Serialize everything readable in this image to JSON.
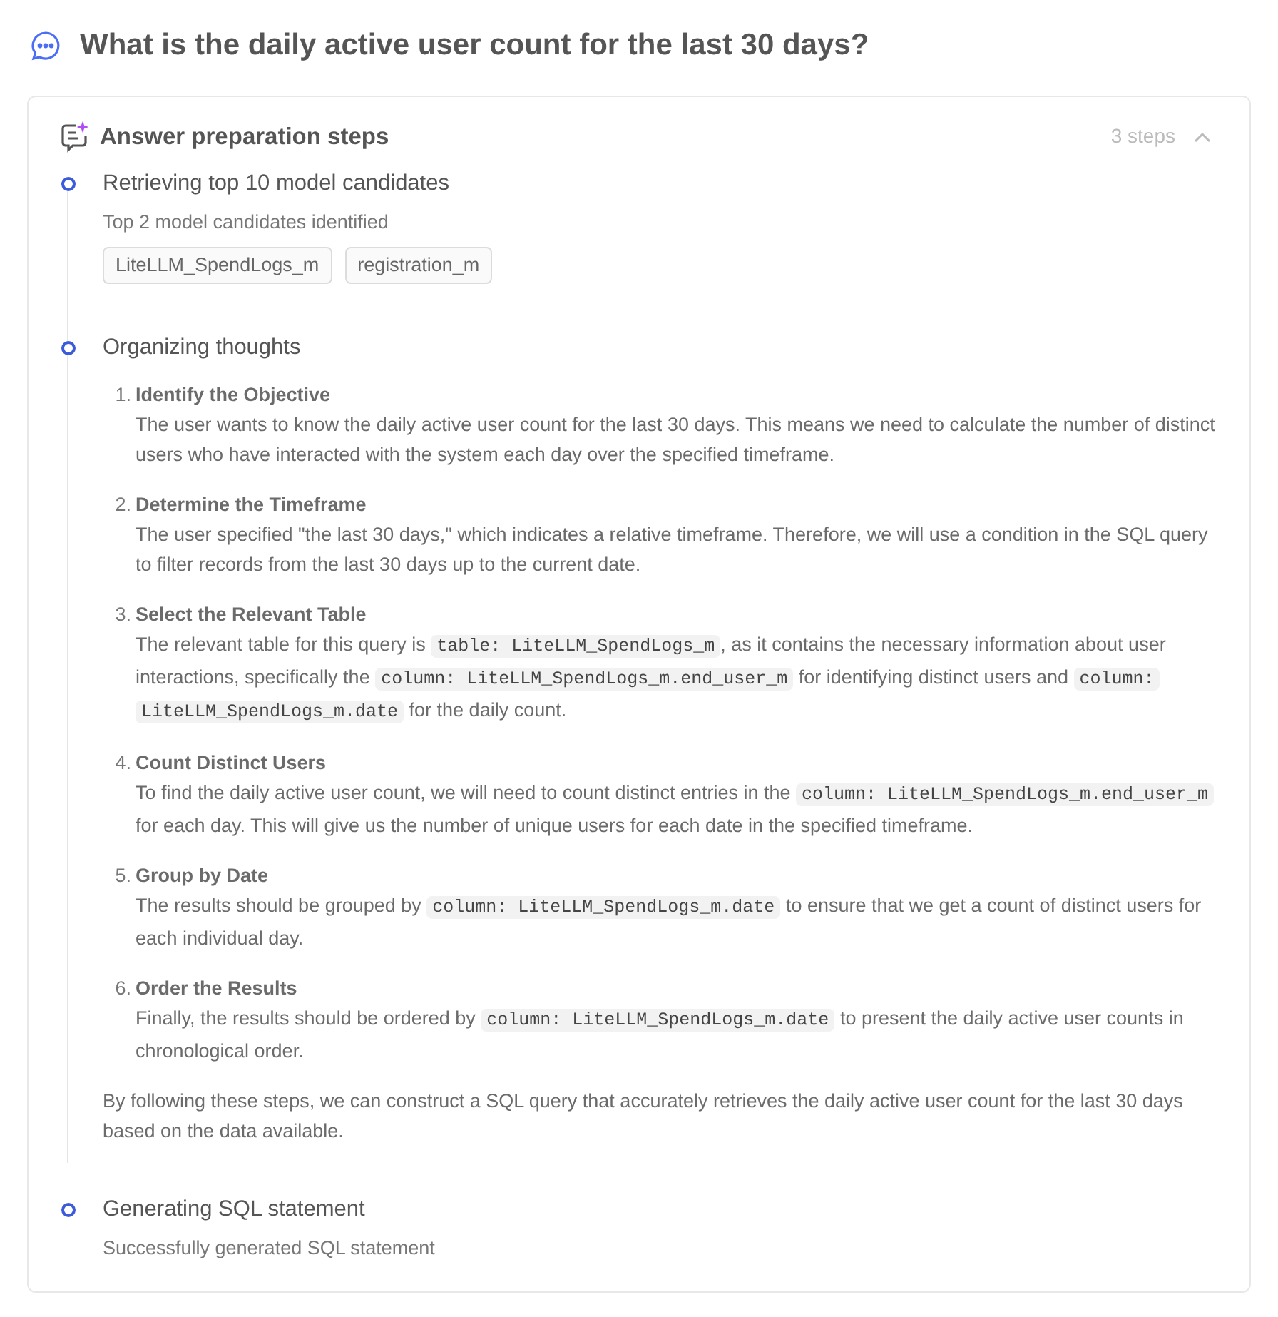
{
  "question": "What is the daily active user count for the last 30 days?",
  "panel": {
    "title": "Answer preparation steps",
    "count": "3 steps",
    "expanded": true
  },
  "steps": [
    {
      "title": "Retrieving top 10 model candidates",
      "note": "Top 2 model candidates identified",
      "tags": [
        "LiteLLM_SpendLogs_m",
        "registration_m"
      ]
    },
    {
      "title": "Organizing thoughts",
      "items": [
        {
          "number": "1.",
          "heading": "Identify the Objective",
          "body": [
            {
              "kind": "text",
              "text": "The user wants to know the daily active user count for the last 30 days. This means we need to calculate the number of distinct users who have interacted with the system each day over the specified timeframe."
            }
          ]
        },
        {
          "number": "2.",
          "heading": "Determine the Timeframe",
          "body": [
            {
              "kind": "text",
              "text": "The user specified \"the last 30 days,\" which indicates a relative timeframe. Therefore, we will use a condition in the SQL query to filter records from the last 30 days up to the current date."
            }
          ]
        },
        {
          "number": "3.",
          "heading": "Select the Relevant Table",
          "body": [
            {
              "kind": "text",
              "text": "The relevant table for this query is "
            },
            {
              "kind": "code",
              "text": "table: LiteLLM_SpendLogs_m"
            },
            {
              "kind": "text",
              "text": ", as it contains the necessary information about user interactions, specifically the "
            },
            {
              "kind": "code",
              "text": "column: LiteLLM_SpendLogs_m.end_user_m"
            },
            {
              "kind": "text",
              "text": " for identifying distinct users and "
            },
            {
              "kind": "code",
              "text": "column: LiteLLM_SpendLogs_m.date"
            },
            {
              "kind": "text",
              "text": " for the daily count."
            }
          ]
        },
        {
          "number": "4.",
          "heading": "Count Distinct Users",
          "body": [
            {
              "kind": "text",
              "text": "To find the daily active user count, we will need to count distinct entries in the "
            },
            {
              "kind": "code",
              "text": "column: LiteLLM_SpendLogs_m.end_user_m"
            },
            {
              "kind": "text",
              "text": " for each day. This will give us the number of unique users for each date in the specified timeframe."
            }
          ]
        },
        {
          "number": "5.",
          "heading": "Group by Date",
          "body": [
            {
              "kind": "text",
              "text": "The results should be grouped by "
            },
            {
              "kind": "code",
              "text": "column: LiteLLM_SpendLogs_m.date"
            },
            {
              "kind": "text",
              "text": " to ensure that we get a count of distinct users for each individual day."
            }
          ]
        },
        {
          "number": "6.",
          "heading": "Order the Results",
          "body": [
            {
              "kind": "text",
              "text": "Finally, the results should be ordered by "
            },
            {
              "kind": "code",
              "text": "column: LiteLLM_SpendLogs_m.date"
            },
            {
              "kind": "text",
              "text": " to present the daily active user counts in chronological order."
            }
          ]
        }
      ],
      "summary": "By following these steps, we can construct a SQL query that accurately retrieves the daily active user count for the last 30 days based on the data available."
    },
    {
      "title": "Generating SQL statement",
      "note": "Successfully generated SQL statement"
    }
  ]
}
